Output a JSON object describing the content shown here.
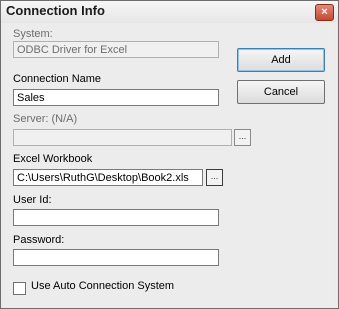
{
  "window": {
    "title": "Connection Info",
    "close_glyph": "×"
  },
  "system": {
    "label": "System:",
    "value": "ODBC Driver for Excel"
  },
  "connection_name": {
    "label": "Connection Name",
    "value": "Sales"
  },
  "server": {
    "label": "Server: (N/A)",
    "value": "",
    "browse_glyph": "..."
  },
  "workbook": {
    "label": "Excel Workbook",
    "value": "C:\\Users\\RuthG\\Desktop\\Book2.xls",
    "browse_glyph": "..."
  },
  "user_id": {
    "label": "User Id:",
    "value": ""
  },
  "password": {
    "label": "Password:",
    "value": ""
  },
  "auto_connect": {
    "label": "Use Auto Connection System",
    "checked": false
  },
  "buttons": {
    "add": "Add",
    "cancel": "Cancel"
  }
}
